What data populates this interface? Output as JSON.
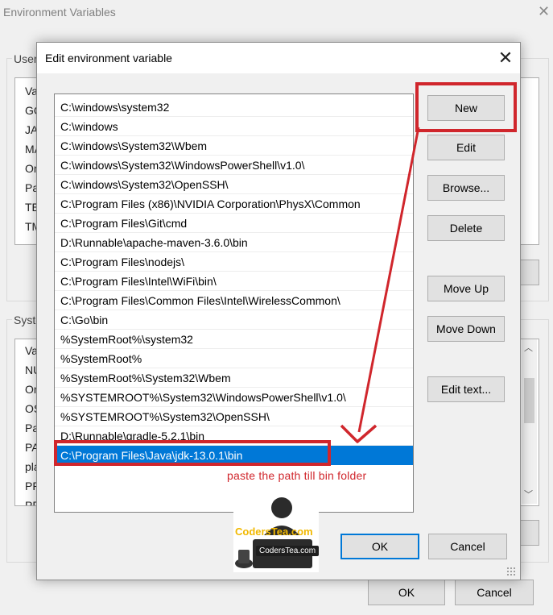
{
  "background_dialog": {
    "title": "Environment Variables",
    "user_group_label": "User",
    "user_list_rows": [
      "Va",
      "GO",
      "JAV",
      "MA",
      "On",
      "Pa",
      "TE",
      "TM"
    ],
    "system_group_label": "Syste",
    "system_list_rows": [
      "Va",
      "NU",
      "On",
      "OS",
      "Pa",
      "PA",
      "pla",
      "PR",
      "PR"
    ],
    "ok_label": "OK",
    "cancel_label": "Cancel"
  },
  "dialog": {
    "title": "Edit environment variable",
    "paths": [
      "C:\\windows\\system32",
      "C:\\windows",
      "C:\\windows\\System32\\Wbem",
      "C:\\windows\\System32\\WindowsPowerShell\\v1.0\\",
      "C:\\windows\\System32\\OpenSSH\\",
      "C:\\Program Files (x86)\\NVIDIA Corporation\\PhysX\\Common",
      "C:\\Program Files\\Git\\cmd",
      "D:\\Runnable\\apache-maven-3.6.0\\bin",
      "C:\\Program Files\\nodejs\\",
      "C:\\Program Files\\Intel\\WiFi\\bin\\",
      "C:\\Program Files\\Common Files\\Intel\\WirelessCommon\\",
      "C:\\Go\\bin",
      "%SystemRoot%\\system32",
      "%SystemRoot%",
      "%SystemRoot%\\System32\\Wbem",
      "%SYSTEMROOT%\\System32\\WindowsPowerShell\\v1.0\\",
      "%SYSTEMROOT%\\System32\\OpenSSH\\",
      "D:\\Runnable\\gradle-5.2.1\\bin",
      "C:\\Program Files\\Java\\jdk-13.0.1\\bin"
    ],
    "selected_path": "C:\\Program Files\\Java\\jdk-13.0.1\\bin",
    "buttons": {
      "new": "New",
      "edit": "Edit",
      "browse": "Browse...",
      "delete": "Delete",
      "move_up": "Move Up",
      "move_down": "Move Down",
      "edit_text": "Edit text...",
      "ok": "OK",
      "cancel": "Cancel"
    }
  },
  "annotation": {
    "note": "paste the path till bin folder",
    "color": "#d0262c"
  },
  "watermark": {
    "text": "CodersTea.com",
    "badge": "CodersTea.com"
  },
  "colors": {
    "selection": "#0078d7",
    "dialog_bg": "#f0f0f0",
    "button_bg": "#e1e1e1"
  }
}
